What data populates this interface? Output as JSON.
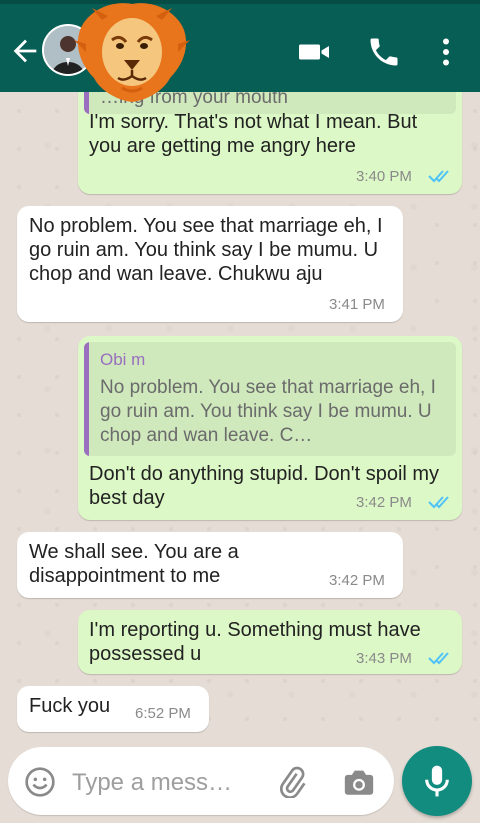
{
  "colors": {
    "header": "#075e54",
    "outgoing": "#dcf8c6",
    "incoming": "#ffffff",
    "accent": "#128c7e",
    "quote_name": "#9a6fbf",
    "read_ticks": "#4fc3f7"
  },
  "header": {
    "icons": [
      "back-arrow-icon",
      "contact-avatar",
      "lion-sticker-icon",
      "video-call-icon",
      "voice-call-icon",
      "more-options-icon"
    ]
  },
  "messages": [
    {
      "direction": "out",
      "partial_text": "…ing from your mouth",
      "text": "I'm sorry. That's not what I mean. But you are getting me angry here",
      "time": "3:40 PM",
      "read": true
    },
    {
      "direction": "in",
      "text": "No problem. You see that marriage eh, I go ruin am. You think say I be mumu. U chop and wan leave. Chukwu aju",
      "time": "3:41 PM"
    },
    {
      "direction": "out",
      "quote": {
        "name": "Obi m",
        "text": "No problem. You see that marriage eh, I go ruin am. You think say I be mumu. U chop and wan leave. C…"
      },
      "text": "Don't do anything stupid. Don't spoil my best day",
      "time": "3:42 PM",
      "read": true
    },
    {
      "direction": "in",
      "text": "We shall see. You are a disappointment to me",
      "time": "3:42 PM"
    },
    {
      "direction": "out",
      "text": "I'm reporting u. Something must have possessed u",
      "time": "3:43 PM",
      "read": true
    },
    {
      "direction": "in",
      "text": "Fuck you",
      "time": "6:52 PM"
    }
  ],
  "composer": {
    "placeholder": "Type a mess…",
    "icons": [
      "emoji-icon",
      "attach-icon",
      "camera-icon",
      "mic-icon"
    ]
  }
}
